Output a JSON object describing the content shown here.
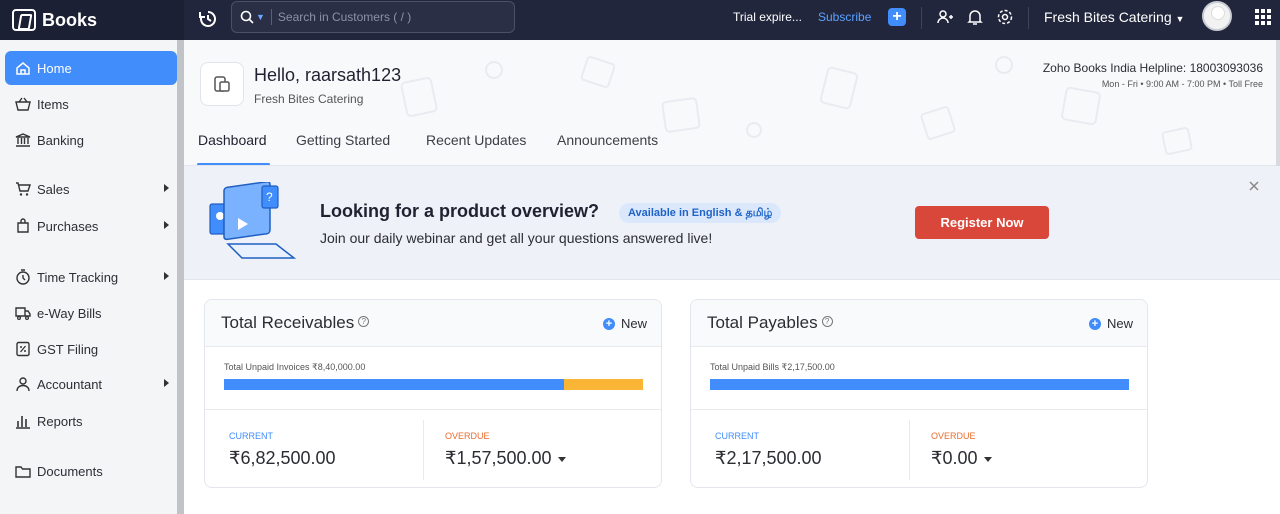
{
  "app": {
    "name": "Books"
  },
  "topbar": {
    "search_placeholder": "Search in Customers ( / )",
    "trial_text": "Trial expire...",
    "subscribe_label": "Subscribe",
    "organization": "Fresh Bites Catering"
  },
  "sidebar": {
    "items": [
      {
        "label": "Home",
        "icon": "home-icon",
        "active": true
      },
      {
        "label": "Items",
        "icon": "basket-icon"
      },
      {
        "label": "Banking",
        "icon": "bank-icon"
      },
      {
        "label": "Sales",
        "icon": "cart-icon",
        "has_submenu": true
      },
      {
        "label": "Purchases",
        "icon": "bag-icon",
        "has_submenu": true
      },
      {
        "label": "Time Tracking",
        "icon": "clock-icon",
        "has_submenu": true
      },
      {
        "label": "e-Way Bills",
        "icon": "truck-icon"
      },
      {
        "label": "GST Filing",
        "icon": "percent-doc-icon"
      },
      {
        "label": "Accountant",
        "icon": "accountant-icon",
        "has_submenu": true
      },
      {
        "label": "Reports",
        "icon": "bar-chart-icon"
      },
      {
        "label": "Documents",
        "icon": "folder-icon"
      }
    ]
  },
  "header": {
    "greeting": "Hello, raarsath123",
    "org_subtitle": "Fresh Bites Catering",
    "helpline": "Zoho Books India Helpline: 18003093036",
    "hours": "Mon - Fri • 9:00 AM - 7:00 PM • Toll Free",
    "tabs": [
      "Dashboard",
      "Getting Started",
      "Recent Updates",
      "Announcements"
    ],
    "active_tab": "Dashboard"
  },
  "banner": {
    "title": "Looking for a product overview?",
    "badge": "Available in English & தமிழ்",
    "subtitle": "Join our daily webinar and get all your questions answered live!",
    "cta": "Register Now"
  },
  "receivables": {
    "title": "Total Receivables",
    "new_label": "New",
    "unpaid_label": "Total Unpaid Invoices ₹8,40,000.00",
    "current_fraction": 0.8125,
    "current_label": "CURRENT",
    "current_amount": "₹6,82,500.00",
    "overdue_label": "OVERDUE",
    "overdue_amount": "₹1,57,500.00"
  },
  "payables": {
    "title": "Total Payables",
    "new_label": "New",
    "unpaid_label": "Total Unpaid Bills ₹2,17,500.00",
    "current_fraction": 1.0,
    "current_label": "CURRENT",
    "current_amount": "₹2,17,500.00",
    "overdue_label": "OVERDUE",
    "overdue_amount": "₹0.00"
  },
  "colors": {
    "accent": "#408dfb",
    "topbar": "#21263c",
    "overdue_bar": "#fbb536",
    "cta": "#d9473a"
  }
}
